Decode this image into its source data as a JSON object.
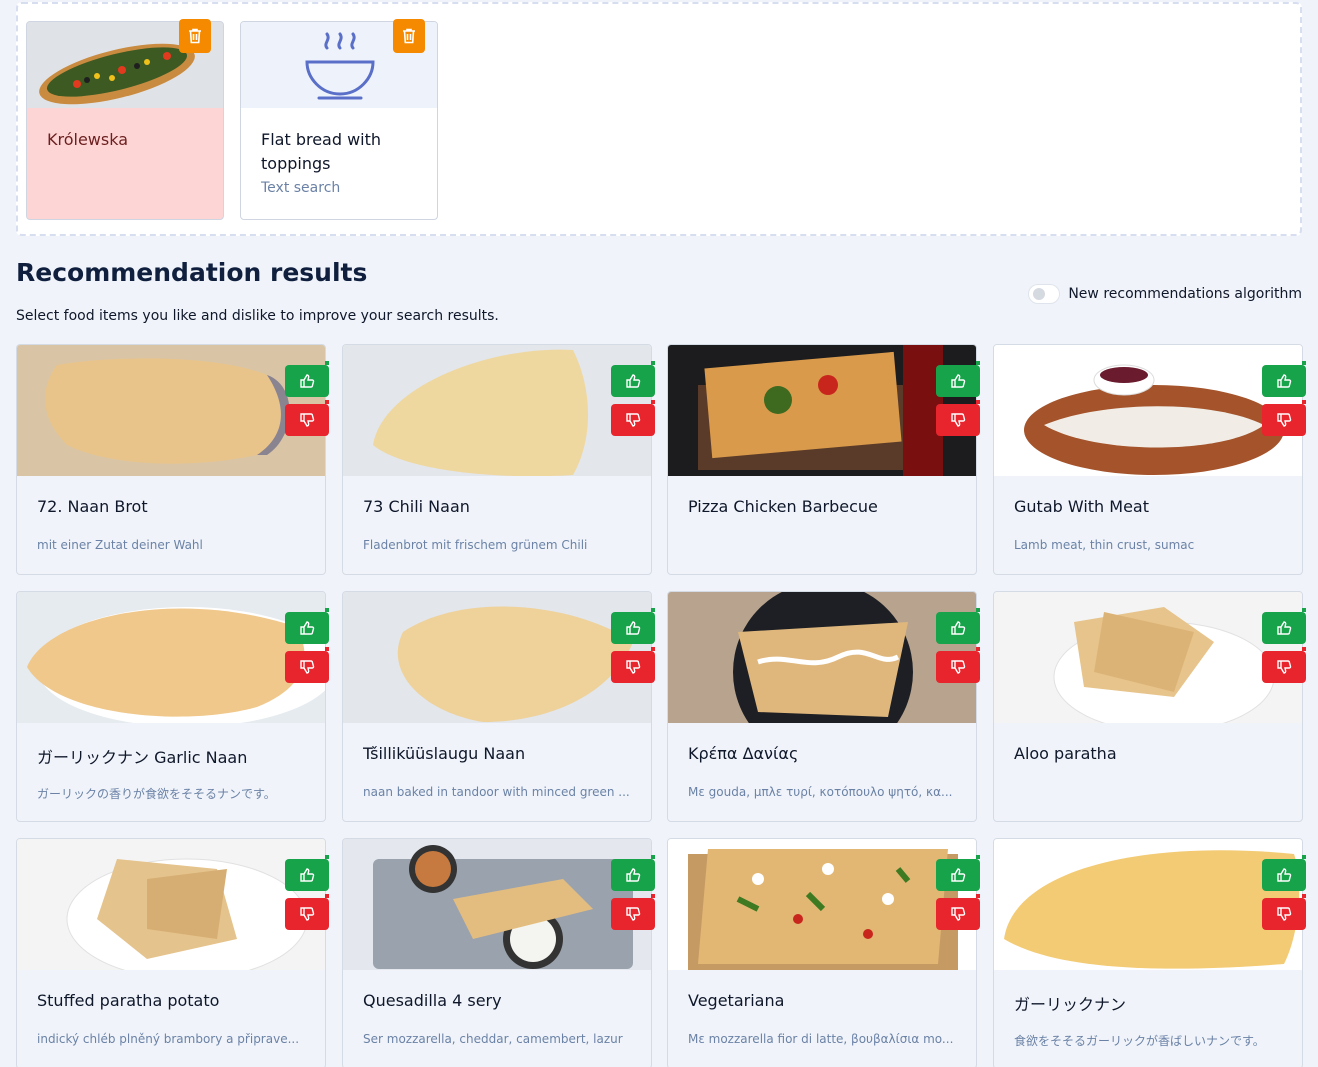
{
  "selected": [
    {
      "title": "Królewska",
      "subtitle": "",
      "state": "liked",
      "image": "pizza-photo"
    },
    {
      "title": "Flat bread with toppings",
      "subtitle": "Text search",
      "state": "neutral",
      "image": "bowl-icon"
    }
  ],
  "heading": "Recommendation results",
  "subheading": "Select food items you like and dislike to improve your search results.",
  "toggle": {
    "label": "New recommendations algorithm",
    "enabled": false
  },
  "colors": {
    "like": "#17a34a",
    "dislike": "#e8242c",
    "delete": "#f58a00",
    "liked_bg": "#fed5d5"
  },
  "results": [
    {
      "title": "72. Naan Brot",
      "desc": "mit einer Zutat deiner Wahl",
      "image": "naan-photo"
    },
    {
      "title": "73 Chili Naan",
      "desc": "Fladenbrot mit frischem grünem Chili",
      "image": "chili-naan-photo"
    },
    {
      "title": "Pizza Chicken Barbecue",
      "desc": "",
      "image": "pizza-bbq-photo"
    },
    {
      "title": "Gutab With Meat",
      "desc": "Lamb meat, thin crust, sumac",
      "image": "gutab-photo"
    },
    {
      "title": "ガーリックナン Garlic Naan",
      "desc": "ガーリックの香りが食欲をそそるナンです。",
      "image": "garlic-naan-photo"
    },
    {
      "title": "Tšilliküüslaugu Naan",
      "desc": "naan baked in tandoor with minced green ...",
      "image": "chili-garlic-naan-photo"
    },
    {
      "title": "Κρέπα Δανίας",
      "desc": "Με gouda, μπλε τυρί, κοτόπουλο ψητό, κα...",
      "image": "crepe-photo"
    },
    {
      "title": "Aloo paratha",
      "desc": "",
      "image": "paratha-photo"
    },
    {
      "title": "Stuffed paratha potato",
      "desc": "indický chléb plněný brambory a připrave...",
      "image": "stuffed-paratha-photo"
    },
    {
      "title": "Quesadilla 4 sery",
      "desc": "Ser mozzarella, cheddar, camembert, lazur",
      "image": "quesadilla-photo"
    },
    {
      "title": "Vegetariana",
      "desc": "Με mozzarella fior di latte, βουβαλίσια mo...",
      "image": "vegetariana-photo"
    },
    {
      "title": "ガーリックナン",
      "desc": "食欲をそそるガーリックが香ばしいナンです。",
      "image": "garlic-naan-2-photo"
    }
  ]
}
